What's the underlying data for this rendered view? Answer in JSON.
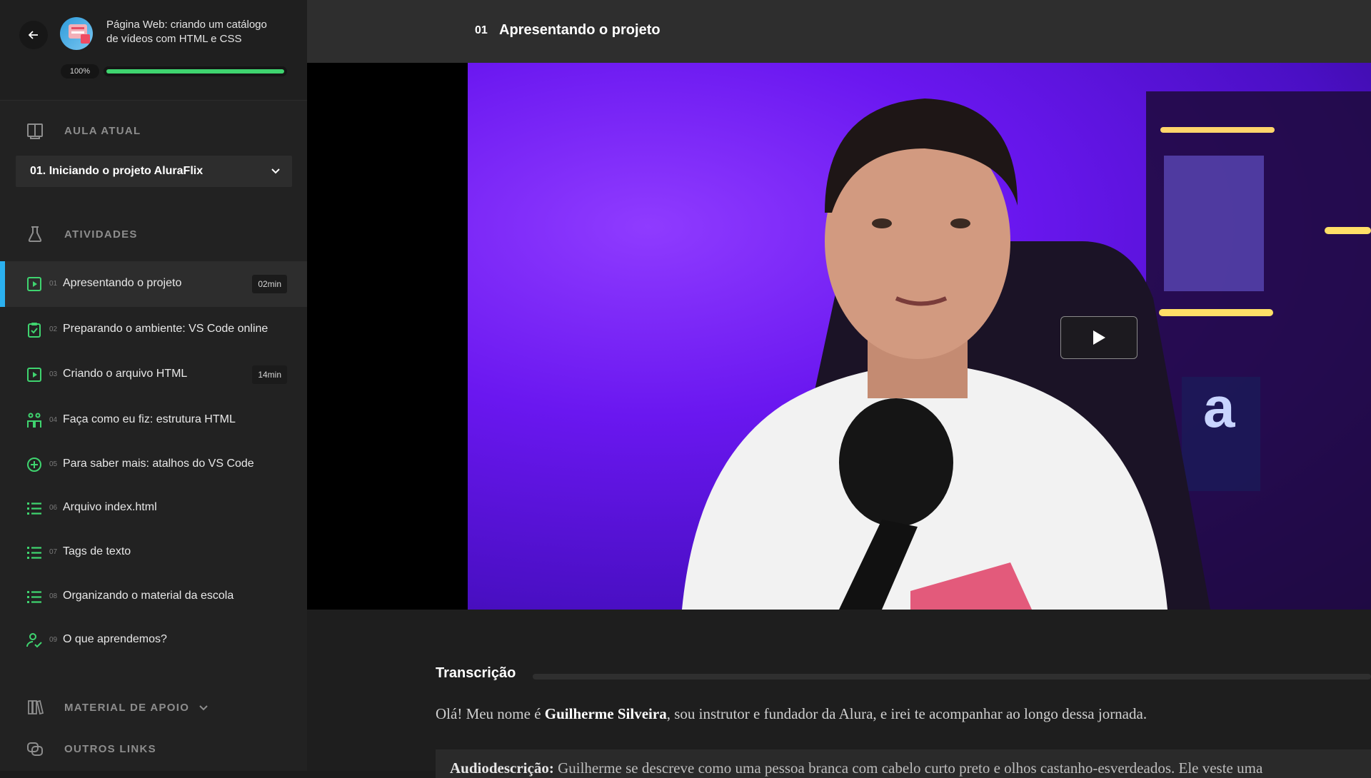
{
  "course": {
    "title": "Página Web: criando um catálogo de vídeos com HTML e CSS",
    "progress_text": "100%",
    "progress": 1.0
  },
  "sidebar": {
    "current_lesson_label": "AULA ATUAL",
    "current_lesson": "01. Iniciando o projeto AluraFlix",
    "activities_label": "ATIVIDADES",
    "support_label": "MATERIAL DE APOIO",
    "links_label": "OUTROS LINKS",
    "activities": [
      {
        "num": "01",
        "label": "Apresentando o projeto",
        "duration": "02min",
        "icon": "play-video-icon",
        "active": true
      },
      {
        "num": "02",
        "label": "Preparando o ambiente: VS Code online",
        "duration": "",
        "icon": "clipboard-check-icon"
      },
      {
        "num": "03",
        "label": "Criando o arquivo HTML",
        "duration": "14min",
        "icon": "play-video-icon"
      },
      {
        "num": "04",
        "label": "Faça como eu fiz: estrutura HTML",
        "duration": "",
        "icon": "people-icon"
      },
      {
        "num": "05",
        "label": "Para saber mais: atalhos do VS Code",
        "duration": "",
        "icon": "plus-circle-icon"
      },
      {
        "num": "06",
        "label": "Arquivo index.html",
        "duration": "",
        "icon": "list-icon"
      },
      {
        "num": "07",
        "label": "Tags de texto",
        "duration": "",
        "icon": "list-icon"
      },
      {
        "num": "08",
        "label": "Organizando o material da escola",
        "duration": "",
        "icon": "list-icon"
      },
      {
        "num": "09",
        "label": "O que aprendemos?",
        "duration": "",
        "icon": "person-check-icon"
      }
    ]
  },
  "header": {
    "number": "01",
    "title": "Apresentando o projeto"
  },
  "transcript": {
    "heading": "Transcrição",
    "p1_before": "Olá! Meu nome é ",
    "p1_bold": "Guilherme Silveira",
    "p1_after": ", sou instrutor e fundador da Alura, e irei te acompanhar ao longo dessa jornada.",
    "audio_bold": "Audiodescrição:",
    "audio_text": " Guilherme se descreve como uma pessoa branca com cabelo curto preto e olhos castanho-esverdeados. Ele veste uma"
  },
  "colors": {
    "accent_blue": "#2bb1f0",
    "accent_green": "#3fd46f"
  }
}
